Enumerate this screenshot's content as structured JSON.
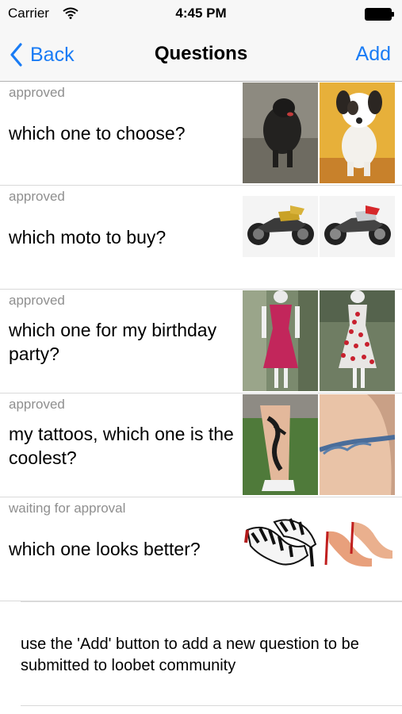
{
  "status_bar": {
    "carrier": "Carrier",
    "time": "4:45 PM"
  },
  "nav": {
    "back_label": "Back",
    "title": "Questions",
    "add_label": "Add"
  },
  "questions": [
    {
      "status": "approved",
      "text": "which one to choose?",
      "images": [
        "black-puppy-photo",
        "white-brown-puppy-photo"
      ]
    },
    {
      "status": "approved",
      "text": "which moto to buy?",
      "images": [
        "gold-motorcycle-photo",
        "silver-motorcycle-photo"
      ]
    },
    {
      "status": "approved",
      "text": "which one for my birthday party?",
      "images": [
        "pink-dress-photo",
        "red-dotted-dress-photo"
      ]
    },
    {
      "status": "approved",
      "text": "my tattoos, which one is the coolest?",
      "images": [
        "leg-tattoo-photo",
        "arm-band-tattoo-photo"
      ]
    },
    {
      "status": "waiting for approval",
      "text": "which one looks better?",
      "images": [
        "zebra-heels-photo",
        "nude-heels-photo"
      ]
    }
  ],
  "footer": {
    "hint": "use the 'Add' button to add a new question to be submitted to loobet community"
  },
  "colors": {
    "accent": "#1a7cf5",
    "muted": "#8f8f8f",
    "bar": "#f7f7f7"
  }
}
